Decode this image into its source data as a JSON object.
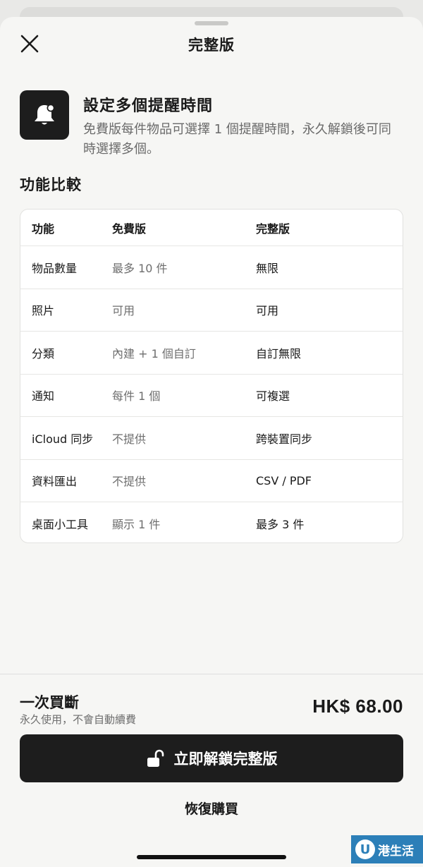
{
  "sheet": {
    "title": "完整版",
    "close_icon": "close-icon"
  },
  "feature": {
    "icon": "bell-icon",
    "title": "設定多個提醒時間",
    "description": "免費版每件物品可選擇 1 個提醒時間，永久解鎖後可同時選擇多個。"
  },
  "comparison": {
    "title": "功能比較",
    "headers": [
      "功能",
      "免費版",
      "完整版"
    ],
    "rows": [
      [
        "物品數量",
        "最多 10 件",
        "無限"
      ],
      [
        "照片",
        "可用",
        "可用"
      ],
      [
        "分類",
        "內建 + 1 個自訂",
        "自訂無限"
      ],
      [
        "通知",
        "每件 1 個",
        "可複選"
      ],
      [
        "iCloud 同步",
        "不提供",
        "跨裝置同步"
      ],
      [
        "資料匯出",
        "不提供",
        "CSV / PDF"
      ],
      [
        "桌面小工具",
        "顯示 1 件",
        "最多 3 件"
      ]
    ]
  },
  "purchase": {
    "title": "一次買斷",
    "subtitle": "永久使用，不會自動續費",
    "price": "HK$ 68.00",
    "unlock_label": "立即解鎖完整版",
    "unlock_icon": "unlock-icon",
    "restore_label": "恢復購買"
  },
  "watermark": {
    "logo_letter": "U",
    "text": "港生活"
  },
  "colors": {
    "background": "#f6f6f4",
    "button": "#1d1d1d",
    "secondary_text": "#6e6e6e",
    "watermark": "#2c7fb8"
  }
}
